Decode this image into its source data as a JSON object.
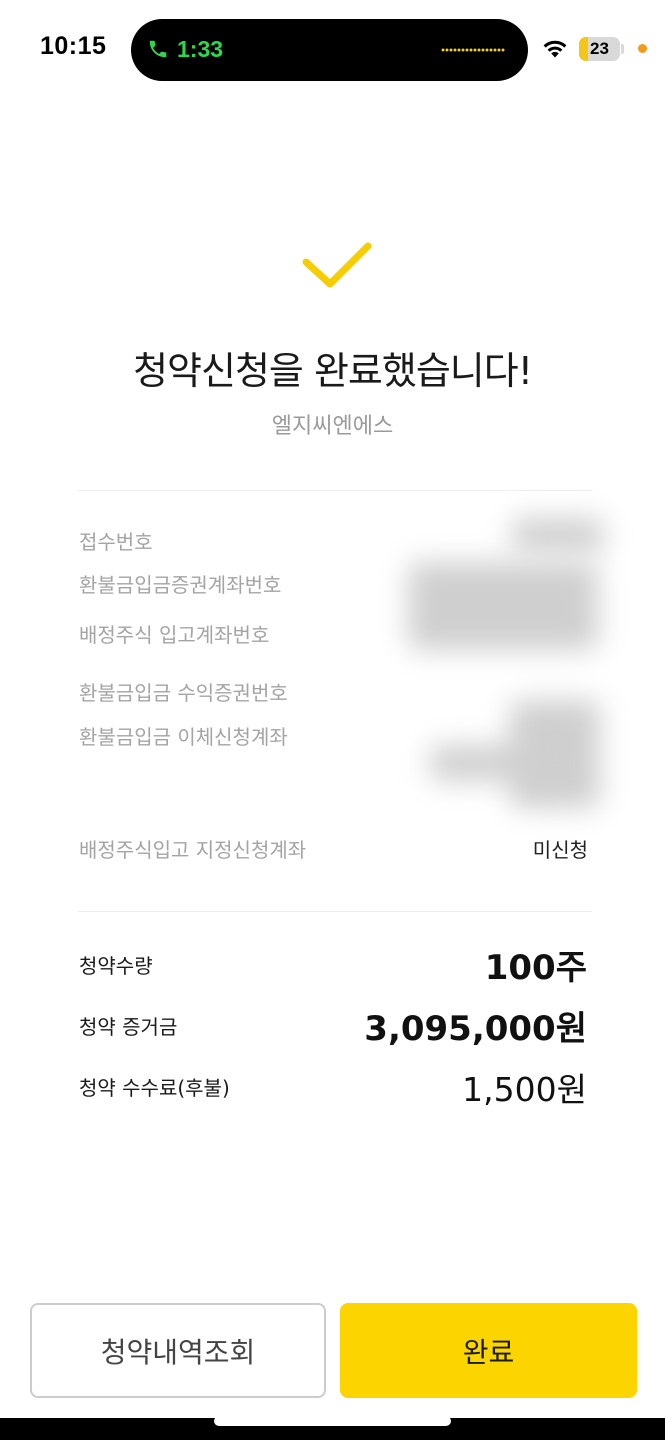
{
  "status_bar": {
    "time": "10:15",
    "call_time": "1:33",
    "battery": "23",
    "battery_level": 0.23,
    "colors": {
      "call": "#2bd94d",
      "battery": "#f5c518",
      "privacy_dot": "#f39a1c"
    },
    "icons": [
      "phone-icon",
      "wifi-icon",
      "battery-icon"
    ]
  },
  "header": {
    "icon": "check-icon",
    "title": "청약신청을 완료했습니다!",
    "company": "엘지씨엔에스"
  },
  "details": {
    "receipt_no_label": "접수번호",
    "refund_account_label": "환불금입금증권계좌번호",
    "stock_account_label": "배정주식 입고계좌번호",
    "refund_broker_label": "환불금입금 수익증권번호",
    "refund_transfer_label": "환불금입금 이체신청계좌",
    "designated_account_label": "배정주식입고 지정신청계좌",
    "designated_account_value": "미신청"
  },
  "summary": {
    "quantity_label": "청약수량",
    "quantity_value": "100주",
    "deposit_label": "청약 증거금",
    "deposit_value": "3,095,000원",
    "fee_label": "청약 수수료(후불)",
    "fee_value": "1,500원"
  },
  "buttons": {
    "history": "청약내역조회",
    "done": "완료"
  },
  "colors": {
    "accent": "#fcd500",
    "check": "#f5cd00"
  }
}
